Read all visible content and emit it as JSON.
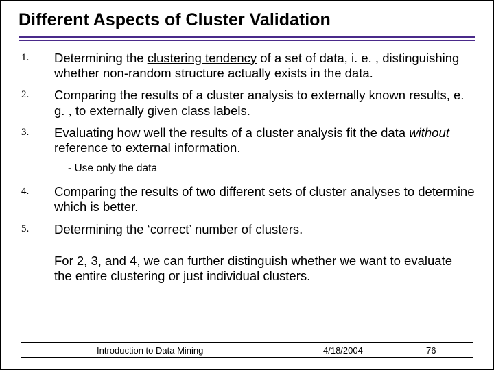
{
  "title": "Different Aspects of Cluster Validation",
  "items": {
    "n1": "1.",
    "t1a": "Determining the ",
    "t1b": "clustering tendency",
    "t1c": " of a set of data, i. e. , distinguishing whether non-random structure actually exists in the data.",
    "n2": "2.",
    "t2": "Comparing the results of a cluster analysis to externally known results, e. g. , to externally given class labels.",
    "n3": "3.",
    "t3a": "Evaluating how well the results of a cluster analysis fit the data ",
    "t3b": "without",
    "t3c": " reference to external information.",
    "sub3": "- Use only the data",
    "n4": "4.",
    "t4": "Comparing the results of two different sets of cluster analyses to determine which is better.",
    "n5": "5.",
    "t5": "Determining the ‘correct’ number of clusters."
  },
  "summary": "For 2, 3, and 4, we can further distinguish whether we want to evaluate the entire clustering or just individual clusters.",
  "footer": {
    "left": "Introduction to Data Mining",
    "mid": "4/18/2004",
    "right": "76"
  }
}
